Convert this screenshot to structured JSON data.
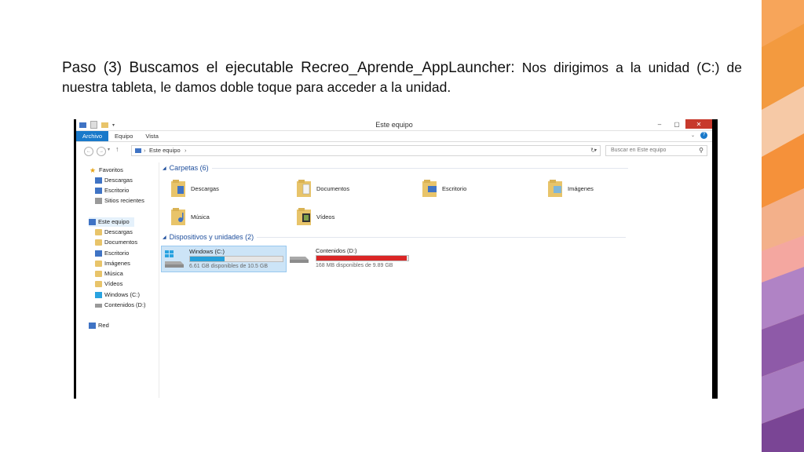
{
  "slide": {
    "heading": "Paso (3) Buscamos el ejecutable Recreo_Aprende_AppLauncher:",
    "body_inline": "Nos dirigimos a la",
    "body_rest": "unidad (C:) de nuestra tableta, le damos doble toque para acceder a la unidad."
  },
  "window": {
    "title": "Este equipo",
    "controls": {
      "minimize": "–",
      "maximize": "▢",
      "close": "✕"
    }
  },
  "menu": {
    "items": [
      "Archivo",
      "Equipo",
      "Vista"
    ],
    "active": "Archivo"
  },
  "address": {
    "back": "←",
    "forward": "→",
    "up": "↑",
    "path": "Este equipo",
    "separator": "›",
    "refresh": "↻"
  },
  "search": {
    "placeholder": "Buscar en Este equipo"
  },
  "nav": {
    "favorites": {
      "label": "Favoritos",
      "items": [
        "Descargas",
        "Escritorio",
        "Sitios recientes"
      ]
    },
    "this_pc": {
      "label": "Este equipo",
      "items": [
        "Descargas",
        "Documentos",
        "Escritorio",
        "Imágenes",
        "Música",
        "Vídeos",
        "Windows (C:)",
        "Contenidos (D:)"
      ]
    },
    "network": {
      "label": "Red"
    }
  },
  "folders": {
    "header": "Carpetas (6)",
    "items": [
      "Descargas",
      "Documentos",
      "Escritorio",
      "Imágenes",
      "Música",
      "Vídeos"
    ]
  },
  "devices": {
    "header": "Dispositivos y unidades (2)",
    "items": [
      {
        "name": "Windows (C:)",
        "free": "6.61 GB disponibles de 10.5 GB",
        "used_fraction": 0.37,
        "bar_color": "#26a0da",
        "selected": true
      },
      {
        "name": "Contenidos (D:)",
        "free": "168 MB disponibles de 9.89 GB",
        "used_fraction": 0.98,
        "bar_color": "#da2626",
        "selected": false
      }
    ]
  },
  "colors": {
    "accent": "#1979ca",
    "close": "#c7392c",
    "orange_deco": "#f39a3f",
    "purple_deco": "#8e5aa8"
  }
}
